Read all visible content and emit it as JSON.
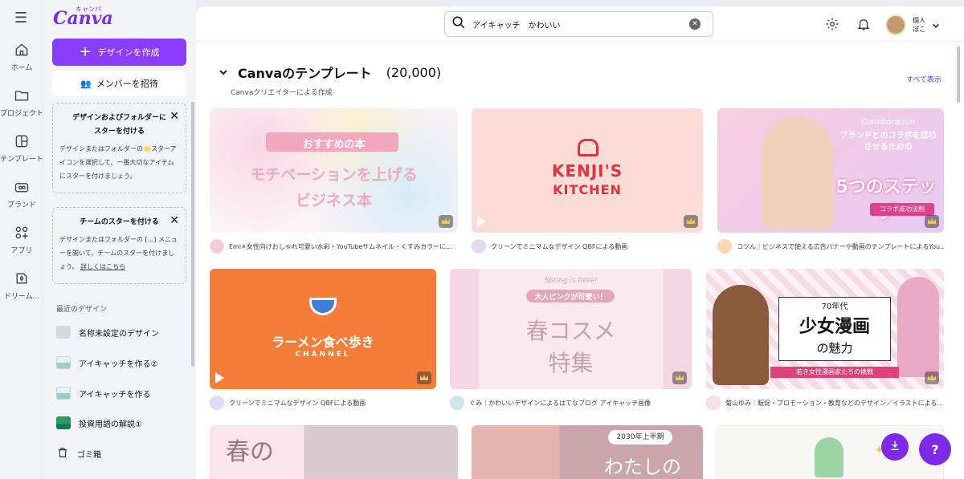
{
  "rail": {
    "items": [
      {
        "label": "ホーム",
        "icon": "home-icon"
      },
      {
        "label": "プロジェクト",
        "icon": "folder-icon"
      },
      {
        "label": "テンプレート",
        "icon": "template-icon"
      },
      {
        "label": "ブランド",
        "icon": "brand-icon"
      },
      {
        "label": "アプリ",
        "icon": "apps-icon"
      },
      {
        "label": "ドリーム...",
        "icon": "dream-icon"
      }
    ]
  },
  "panel": {
    "logo": "Canva",
    "logo_sub": "キャンバ",
    "create_label": "デザインを作成",
    "invite_label": "メンバーを招待",
    "tip1_title": "デザインおよびフォルダーにスターを付ける",
    "tip1_body": "デザインまたはフォルダーの⭐スターアイコンを選択して、一番大切なアイテムにスターを付けましょう。",
    "tip2_title": "チームのスターを付ける",
    "tip2_body": "デザインまたはフォルダーの [...] メニューを開いて、チームのスターを付けましょう。",
    "tip2_link": "詳しくはこちら",
    "recent_heading": "最近のデザイン",
    "recent": [
      "名称未設定のデザイン",
      "アイキャッチを作る②",
      "アイキャッチを作る",
      "投資用語の解説①"
    ],
    "trash_label": "ゴミ箱"
  },
  "topbar": {
    "search_value": "アイキャッチ　かわいい",
    "account_line1": "個人",
    "account_line2": "ぽこ"
  },
  "section": {
    "title": "Canvaのテンプレート",
    "count": "(20,000)",
    "subtitle": "Canvaクリエイターによる作成",
    "see_all": "すべて表示"
  },
  "cards": [
    {
      "text1": "おすすめの本",
      "text2": "モチベーションを上げる",
      "text3": "ビジネス本",
      "meta": "Emi✳︎女性向けおしゃれ可愛い水彩・YouTubeサムネイル・くすみカラーに..."
    },
    {
      "text1": "KENJI'S",
      "text2": "KITCHEN",
      "meta": "クリーンでミニマムなデザイン QBFによる動画"
    },
    {
      "text1": "Collaboration",
      "text2": "ブランドとのコラボを成功させるための",
      "text3": "5つのステップ",
      "text4": "コラボ成功法則",
      "meta": "コツん｜ビジネスで使える広告バナーや動画のテンプレートによるYou..."
    },
    {
      "text1": "ラーメン食べ歩き",
      "text2": "CHANNEL",
      "meta": "クリーンでミニマムなデザイン QBFによる動画"
    },
    {
      "text1": "Spring is here!",
      "text2": "大人ピンクが可愛い！",
      "text3": "春コスメ",
      "text4": "特集",
      "meta": "ぐみ｜かわいいデザインによるはてなブログ アイキャッチ画像"
    },
    {
      "text1": "70年代",
      "text2": "少女漫画",
      "text3": "の魅力",
      "text4": "若き女性漫画家たちの挑戦",
      "meta": "菊山ゆみ｜販促・プロモーション・教育などのデザイン／イラストによる..."
    },
    {
      "text1": "春の"
    },
    {
      "text1": "2030年上半期",
      "text2": "わたしの"
    },
    {
      "text1": ""
    }
  ]
}
